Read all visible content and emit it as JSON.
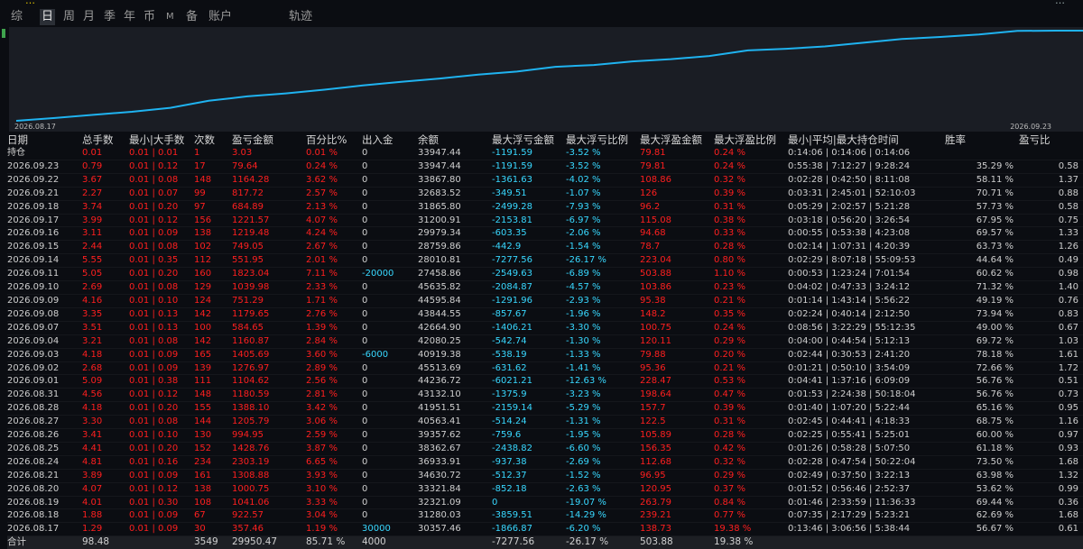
{
  "window": {
    "title": "…",
    "title_right": "…"
  },
  "tabs": [
    {
      "label": "综",
      "active": false
    },
    {
      "label": "日",
      "active": true
    },
    {
      "label": "周",
      "active": false
    },
    {
      "label": "月",
      "active": false
    },
    {
      "label": "季",
      "active": false
    },
    {
      "label": "年",
      "active": false
    },
    {
      "label": "币",
      "active": false
    },
    {
      "label": "M",
      "active": false
    },
    {
      "label": "备",
      "active": false
    },
    {
      "label": "账户",
      "active": false
    },
    {
      "label": "轨迹",
      "active": false
    }
  ],
  "chart_data": {
    "type": "line",
    "x_start": "2026.08.17",
    "x_end": "2026.09.23",
    "color": "#1fb3f0",
    "x": [
      "2026.08.17",
      "2026.08.18",
      "2026.08.19",
      "2026.08.20",
      "2026.08.21",
      "2026.08.24",
      "2026.08.25",
      "2026.08.26",
      "2026.08.27",
      "2026.08.28",
      "2026.08.31",
      "2026.09.01",
      "2026.09.02",
      "2026.09.03",
      "2026.09.04",
      "2026.09.07",
      "2026.09.08",
      "2026.09.09",
      "2026.09.10",
      "2026.09.11",
      "2026.09.14",
      "2026.09.15",
      "2026.09.16",
      "2026.09.17",
      "2026.09.18",
      "2026.09.21",
      "2026.09.22",
      "2026.09.23"
    ],
    "values": [
      30357.46,
      31280.03,
      32321.09,
      33321.84,
      34630.72,
      36933.91,
      38362.67,
      39357.62,
      40563.41,
      41951.51,
      43132.1,
      44236.72,
      45513.69,
      46519.83,
      48080.25,
      48664.9,
      49844.55,
      50595.84,
      51635.82,
      53458.23,
      54009.51,
      54758.86,
      55979.34,
      57200.91,
      57865.8,
      58683.52,
      59867.8,
      59947.44
    ]
  },
  "table": {
    "headers": [
      "日期",
      "总手数",
      "最小|大手数",
      "次数",
      "盈亏金额",
      "百分比%",
      "出入金",
      "余额",
      "最大浮亏金额",
      "最大浮亏比例",
      "最大浮盈金额",
      "最大浮盈比例",
      "最小|平均|最大持仓时间",
      "胜率",
      "盈亏比"
    ],
    "holding_label": "持仓",
    "rows": [
      [
        "2026.09.23",
        "0.79",
        "0.01 | 0.12",
        "17",
        "79.64",
        "0.24 %",
        "0",
        "33947.44",
        "-1191.59",
        "-3.52 %",
        "79.81",
        "0.24 %",
        "0:55:38 | 7:12:27 | 9:28:24",
        "35.29 %",
        "0.58"
      ],
      [
        "2026.09.22",
        "3.67",
        "0.01 | 0.08",
        "148",
        "1164.28",
        "3.62 %",
        "0",
        "33867.80",
        "-1361.63",
        "-4.02 %",
        "108.86",
        "0.32 %",
        "0:02:28 | 0:42:50 | 8:11:08",
        "58.11 %",
        "1.37"
      ],
      [
        "2026.09.21",
        "2.27",
        "0.01 | 0.07",
        "99",
        "817.72",
        "2.57 %",
        "0",
        "32683.52",
        "-349.51",
        "-1.07 %",
        "126",
        "0.39 %",
        "0:03:31 | 2:45:01 | 52:10:03",
        "70.71 %",
        "0.88"
      ],
      [
        "2026.09.18",
        "3.74",
        "0.01 | 0.20",
        "97",
        "684.89",
        "2.13 %",
        "0",
        "31865.80",
        "-2499.28",
        "-7.93 %",
        "96.2",
        "0.31 %",
        "0:05:29 | 2:02:57 | 5:21:28",
        "57.73 %",
        "0.58"
      ],
      [
        "2026.09.17",
        "3.99",
        "0.01 | 0.12",
        "156",
        "1221.57",
        "4.07 %",
        "0",
        "31200.91",
        "-2153.81",
        "-6.97 %",
        "115.08",
        "0.38 %",
        "0:03:18 | 0:56:20 | 3:26:54",
        "67.95 %",
        "0.75"
      ],
      [
        "2026.09.16",
        "3.11",
        "0.01 | 0.09",
        "138",
        "1219.48",
        "4.24 %",
        "0",
        "29979.34",
        "-603.35",
        "-2.06 %",
        "94.68",
        "0.33 %",
        "0:00:55 | 0:53:38 | 4:23:08",
        "69.57 %",
        "1.33"
      ],
      [
        "2026.09.15",
        "2.44",
        "0.01 | 0.08",
        "102",
        "749.05",
        "2.67 %",
        "0",
        "28759.86",
        "-442.9",
        "-1.54 %",
        "78.7",
        "0.28 %",
        "0:02:14 | 1:07:31 | 4:20:39",
        "63.73 %",
        "1.26"
      ],
      [
        "2026.09.14",
        "5.55",
        "0.01 | 0.35",
        "112",
        "551.95",
        "2.01 %",
        "0",
        "28010.81",
        "-7277.56",
        "-26.17 %",
        "223.04",
        "0.80 %",
        "0:02:29 | 8:07:18 | 55:09:53",
        "44.64 %",
        "0.49"
      ],
      [
        "2026.09.11",
        "5.05",
        "0.01 | 0.20",
        "160",
        "1823.04",
        "7.11 %",
        "-20000",
        "27458.86",
        "-2549.63",
        "-6.89 %",
        "503.88",
        "1.10 %",
        "0:00:53 | 1:23:24 | 7:01:54",
        "60.62 %",
        "0.98"
      ],
      [
        "2026.09.10",
        "2.69",
        "0.01 | 0.08",
        "129",
        "1039.98",
        "2.33 %",
        "0",
        "45635.82",
        "-2084.87",
        "-4.57 %",
        "103.86",
        "0.23 %",
        "0:04:02 | 0:47:33 | 3:24:12",
        "71.32 %",
        "1.40"
      ],
      [
        "2026.09.09",
        "4.16",
        "0.01 | 0.10",
        "124",
        "751.29",
        "1.71 %",
        "0",
        "44595.84",
        "-1291.96",
        "-2.93 %",
        "95.38",
        "0.21 %",
        "0:01:14 | 1:43:14 | 5:56:22",
        "49.19 %",
        "0.76"
      ],
      [
        "2026.09.08",
        "3.35",
        "0.01 | 0.13",
        "142",
        "1179.65",
        "2.76 %",
        "0",
        "43844.55",
        "-857.67",
        "-1.96 %",
        "148.2",
        "0.35 %",
        "0:02:24 | 0:40:14 | 2:12:50",
        "73.94 %",
        "0.83"
      ],
      [
        "2026.09.07",
        "3.51",
        "0.01 | 0.13",
        "100",
        "584.65",
        "1.39 %",
        "0",
        "42664.90",
        "-1406.21",
        "-3.30 %",
        "100.75",
        "0.24 %",
        "0:08:56 | 3:22:29 | 55:12:35",
        "49.00 %",
        "0.67"
      ],
      [
        "2026.09.04",
        "3.21",
        "0.01 | 0.08",
        "142",
        "1160.87",
        "2.84 %",
        "0",
        "42080.25",
        "-542.74",
        "-1.30 %",
        "120.11",
        "0.29 %",
        "0:04:00 | 0:44:54 | 5:12:13",
        "69.72 %",
        "1.03"
      ],
      [
        "2026.09.03",
        "4.18",
        "0.01 | 0.09",
        "165",
        "1405.69",
        "3.60 %",
        "-6000",
        "40919.38",
        "-538.19",
        "-1.33 %",
        "79.88",
        "0.20 %",
        "0:02:44 | 0:30:53 | 2:41:20",
        "78.18 %",
        "1.61"
      ],
      [
        "2026.09.02",
        "2.68",
        "0.01 | 0.09",
        "139",
        "1276.97",
        "2.89 %",
        "0",
        "45513.69",
        "-631.62",
        "-1.41 %",
        "95.36",
        "0.21 %",
        "0:01:21 | 0:50:10 | 3:54:09",
        "72.66 %",
        "1.72"
      ],
      [
        "2026.09.01",
        "5.09",
        "0.01 | 0.38",
        "111",
        "1104.62",
        "2.56 %",
        "0",
        "44236.72",
        "-6021.21",
        "-12.63 %",
        "228.47",
        "0.53 %",
        "0:04:41 | 1:37:16 | 6:09:09",
        "56.76 %",
        "0.51"
      ],
      [
        "2026.08.31",
        "4.56",
        "0.01 | 0.12",
        "148",
        "1180.59",
        "2.81 %",
        "0",
        "43132.10",
        "-1375.9",
        "-3.23 %",
        "198.64",
        "0.47 %",
        "0:01:53 | 2:24:38 | 50:18:04",
        "56.76 %",
        "0.73"
      ],
      [
        "2026.08.28",
        "4.18",
        "0.01 | 0.20",
        "155",
        "1388.10",
        "3.42 %",
        "0",
        "41951.51",
        "-2159.14",
        "-5.29 %",
        "157.7",
        "0.39 %",
        "0:01:40 | 1:07:20 | 5:22:44",
        "65.16 %",
        "0.95"
      ],
      [
        "2026.08.27",
        "3.30",
        "0.01 | 0.08",
        "144",
        "1205.79",
        "3.06 %",
        "0",
        "40563.41",
        "-514.24",
        "-1.31 %",
        "122.5",
        "0.31 %",
        "0:02:45 | 0:44:41 | 4:18:33",
        "68.75 %",
        "1.16"
      ],
      [
        "2026.08.26",
        "3.41",
        "0.01 | 0.10",
        "130",
        "994.95",
        "2.59 %",
        "0",
        "39357.62",
        "-759.6",
        "-1.95 %",
        "105.89",
        "0.28 %",
        "0:02:25 | 0:55:41 | 5:25:01",
        "60.00 %",
        "0.97"
      ],
      [
        "2026.08.25",
        "4.41",
        "0.01 | 0.20",
        "152",
        "1428.76",
        "3.87 %",
        "0",
        "38362.67",
        "-2438.82",
        "-6.60 %",
        "156.35",
        "0.42 %",
        "0:01:26 | 0:58:28 | 5:07:50",
        "61.18 %",
        "0.93"
      ],
      [
        "2026.08.24",
        "4.81",
        "0.01 | 0.16",
        "234",
        "2303.19",
        "6.65 %",
        "0",
        "36933.91",
        "-937.38",
        "-2.69 %",
        "112.68",
        "0.32 %",
        "0:02:28 | 0:47:54 | 50:22:04",
        "73.50 %",
        "1.68"
      ],
      [
        "2026.08.21",
        "3.89",
        "0.01 | 0.09",
        "161",
        "1308.88",
        "3.93 %",
        "0",
        "34630.72",
        "-512.37",
        "-1.52 %",
        "96.95",
        "0.29 %",
        "0:02:49 | 0:37:50 | 3:22:13",
        "63.98 %",
        "1.32"
      ],
      [
        "2026.08.20",
        "4.07",
        "0.01 | 0.12",
        "138",
        "1000.75",
        "3.10 %",
        "0",
        "33321.84",
        "-852.18",
        "-2.63 %",
        "120.95",
        "0.37 %",
        "0:01:52 | 0:56:46 | 2:52:37",
        "53.62 %",
        "0.99"
      ],
      [
        "2026.08.19",
        "4.01",
        "0.01 | 0.30",
        "108",
        "1041.06",
        "3.33 %",
        "0",
        "32321.09",
        "0",
        "-19.07 %",
        "263.79",
        "0.84 %",
        "0:01:46 | 2:33:59 | 11:36:33",
        "69.44 %",
        "0.36"
      ],
      [
        "2026.08.18",
        "1.88",
        "0.01 | 0.09",
        "67",
        "922.57",
        "3.04 %",
        "0",
        "31280.03",
        "-3859.51",
        "-14.29 %",
        "239.21",
        "0.77 %",
        "0:07:35 | 2:17:29 | 5:23:21",
        "62.69 %",
        "1.68"
      ],
      [
        "2026.08.17",
        "1.29",
        "0.01 | 0.09",
        "30",
        "357.46",
        "1.19 %",
        "30000",
        "30357.46",
        "-1866.87",
        "-6.20 %",
        "138.73",
        "19.38 %",
        "0:13:46 | 3:06:56 | 5:38:44",
        "56.67 %",
        "0.61"
      ]
    ],
    "holding_row": [
      "0.01",
      "0.01 | 0.01",
      "1",
      "3.03",
      "0.01 %",
      "0",
      "33947.44",
      "-1191.59",
      "-3.52 %",
      "79.81",
      "0.24 %",
      "0:14:06 | 0:14:06 | 0:14:06",
      "",
      ""
    ],
    "total_row": [
      "合计",
      "98.48",
      "",
      "3549",
      "29950.47",
      "85.71 %",
      "4000",
      "",
      "-7277.56",
      "-26.17 %",
      "503.88",
      "19.38 %",
      "",
      "",
      ""
    ]
  }
}
